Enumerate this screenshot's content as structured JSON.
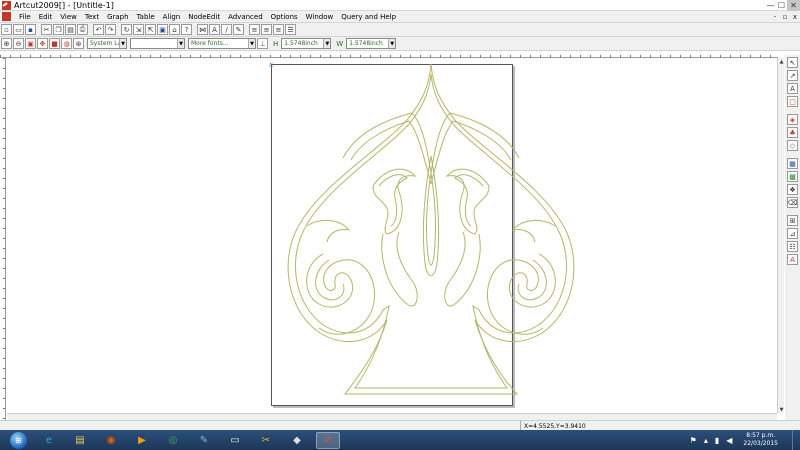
{
  "window": {
    "title": "Artcut2009[] - [Untitle-1]",
    "controls": {
      "minimize": "—",
      "maximize": "☐",
      "close": "✕"
    }
  },
  "menubar": {
    "items": [
      "File",
      "Edit",
      "View",
      "Text",
      "Graph",
      "Table",
      "Align",
      "NodeEdit",
      "Advanced",
      "Options",
      "Window",
      "Query and Help"
    ],
    "mdi_controls": {
      "minimize": "-",
      "restore": "▫",
      "close": "x"
    }
  },
  "toolbar2": {
    "layer_combo": "System Lay",
    "font_style_combo": "",
    "fonts_combo": "More fonts...",
    "height_label": "H",
    "height_value": "1.5748inch",
    "width_label": "W",
    "width_value": "1.5748inch"
  },
  "canvas": {
    "origin_label": "X",
    "stroke_color": "#b5b56a",
    "page_border_color": "#555555"
  },
  "statusbar": {
    "coordinates": "X=4.5525,Y=3.9410"
  },
  "taskbar": {
    "start_icon": "windows-start-orb",
    "apps": [
      {
        "name": "ie-icon",
        "glyph": "e",
        "color": "#3aa0e8"
      },
      {
        "name": "explorer-icon",
        "glyph": "▤",
        "color": "#f1c75b"
      },
      {
        "name": "firefox-icon",
        "glyph": "◉",
        "color": "#e66000"
      },
      {
        "name": "media-player-icon",
        "glyph": "▶",
        "color": "#f39c12"
      },
      {
        "name": "chrome-icon",
        "glyph": "◎",
        "color": "#4caf50"
      },
      {
        "name": "paint-icon",
        "glyph": "✎",
        "color": "#8ab4d8"
      },
      {
        "name": "document-icon",
        "glyph": "▭",
        "color": "#e8e8e8"
      },
      {
        "name": "cut-app-icon",
        "glyph": "✂",
        "color": "#f0b030"
      },
      {
        "name": "inkscape-icon",
        "glyph": "◆",
        "color": "#dddddd"
      },
      {
        "name": "artcut-icon",
        "glyph": "✐",
        "color": "#e74c3c"
      }
    ],
    "time": "8:57 p.m.",
    "date": "22/03/2015"
  }
}
